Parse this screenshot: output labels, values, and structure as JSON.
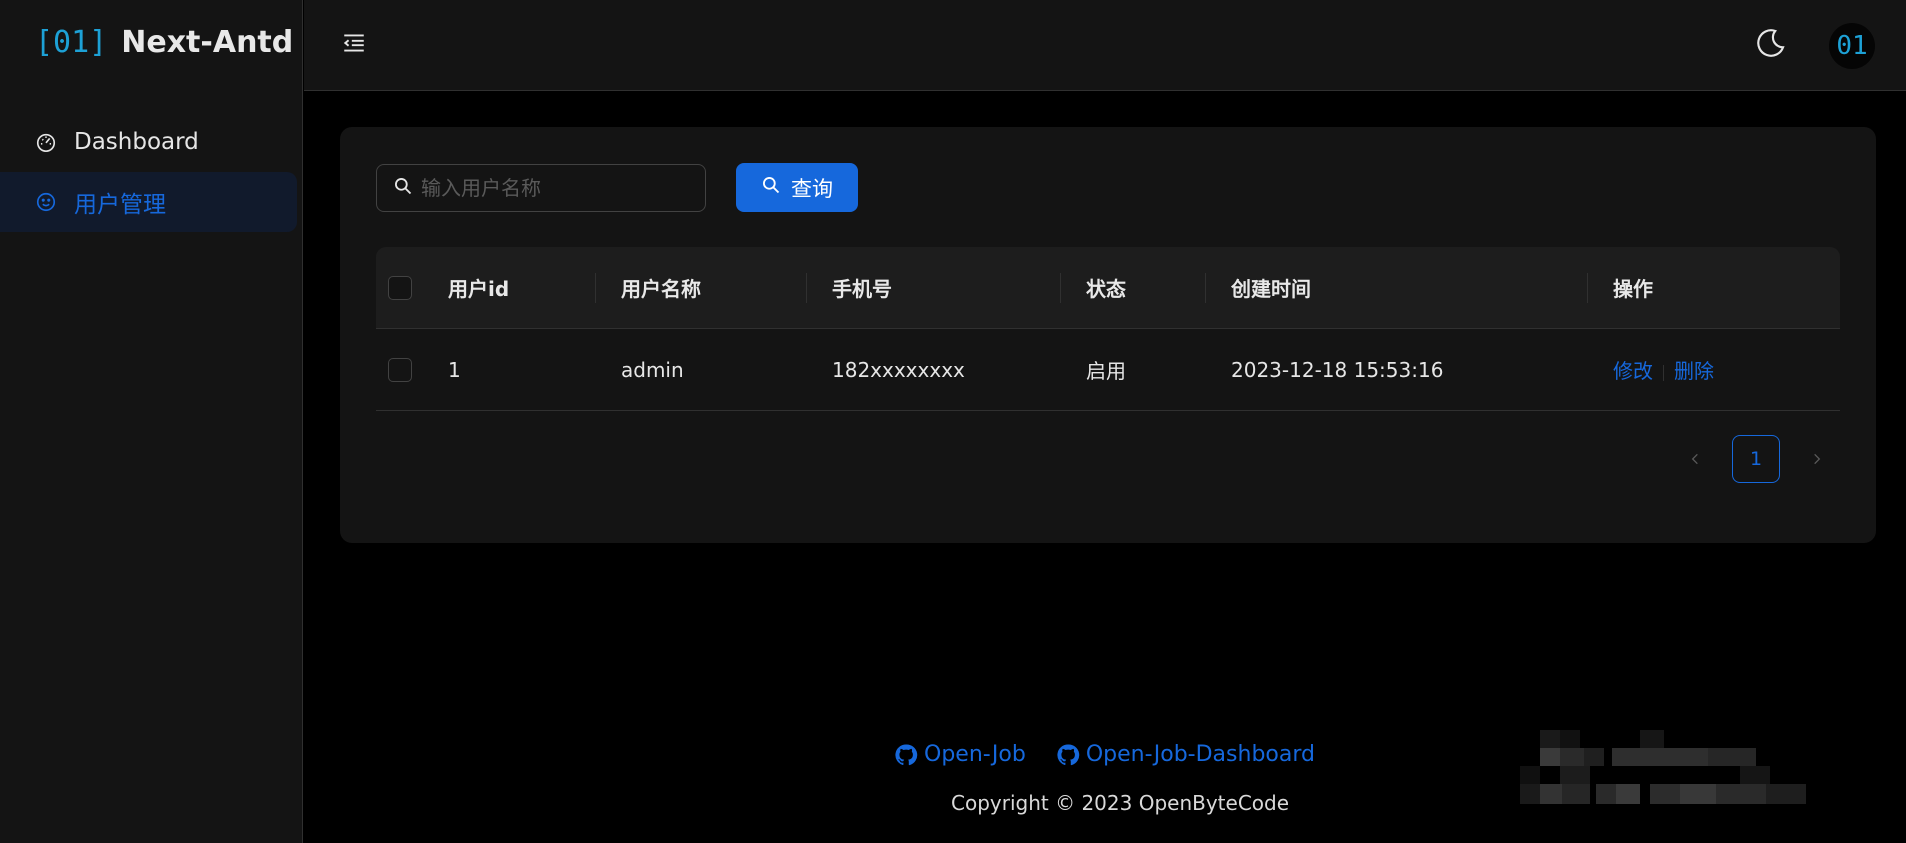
{
  "sidebar": {
    "logo_mark": "[01]",
    "logo_text": "Next-Antd",
    "items": [
      {
        "label": "Dashboard",
        "icon": "dashboard-icon",
        "active": false
      },
      {
        "label": "用户管理",
        "icon": "smile-icon",
        "active": true
      }
    ]
  },
  "header": {
    "collapse_icon": "menu-fold-icon",
    "theme_icon": "moon-icon",
    "avatar_text": "01"
  },
  "search": {
    "placeholder": "输入用户名称",
    "value": "",
    "button_label": "查询"
  },
  "table": {
    "columns": [
      "用户id",
      "用户名称",
      "手机号",
      "状态",
      "创建时间",
      "操作"
    ],
    "rows": [
      {
        "id": "1",
        "name": "admin",
        "phone": "182xxxxxxxx",
        "status": "启用",
        "created": "2023-12-18 15:53:16",
        "edit": "修改",
        "delete": "删除"
      }
    ]
  },
  "pagination": {
    "current": "1"
  },
  "footer": {
    "links": [
      "Open-Job",
      "Open-Job-Dashboard"
    ],
    "copyright": "Copyright © 2023 OpenByteCode"
  },
  "colors": {
    "primary": "#1668dc",
    "logo": "#1da1d6",
    "bg": "#000000",
    "surface": "#141414"
  }
}
